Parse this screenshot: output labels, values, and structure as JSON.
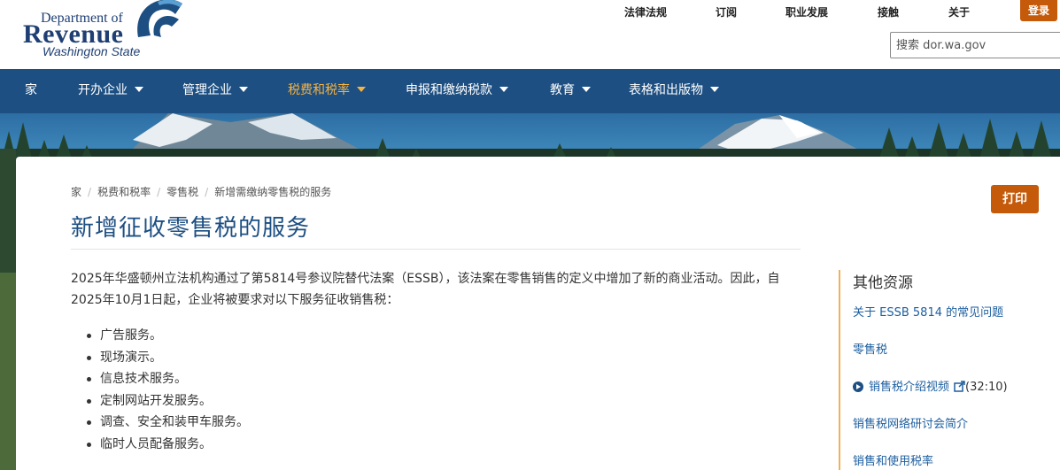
{
  "logo": {
    "line1": "Department of",
    "line2": "Revenue",
    "line3": "Washington State"
  },
  "util_nav": {
    "laws": "法律法规",
    "subscribe": "订阅",
    "careers": "职业发展",
    "contact": "接触",
    "about": "关于",
    "login": "登录"
  },
  "search": {
    "placeholder": "搜索 dor.wa.gov"
  },
  "main_nav": {
    "home": "家",
    "start_business": "开办企业",
    "manage_business": "管理企业",
    "taxes_rates": "税费和税率",
    "file_pay": "申报和缴纳税款",
    "education": "教育",
    "forms_pubs": "表格和出版物"
  },
  "breadcrumb": {
    "home": "家",
    "taxes_rates": "税费和税率",
    "retail_sales_tax": "零售税",
    "current": "新增需缴纳零售税的服务"
  },
  "print_label": "打印",
  "page_title": "新增征收零售税的服务",
  "intro": "2025年华盛顿州立法机构通过了第5814号参议院替代法案（ESSB），该法案在零售销售的定义中增加了新的商业活动。因此，自2025年10月1日起，企业将被要求对以下服务征收销售税：",
  "services": [
    "广告服务。",
    "现场演示。",
    "信息技术服务。",
    "定制网站开发服务。",
    "调查、安全和装甲车服务。",
    "临时人员配备服务。"
  ],
  "sidebar": {
    "title": "其他资源",
    "links": [
      "关于 ESSB 5814 的常见问题",
      "零售税",
      "销售税介绍视频",
      "销售税网络研讨会简介",
      "销售和使用税率"
    ],
    "video_duration": "(32:10)"
  },
  "colors": {
    "brand_blue": "#1d4f82",
    "accent_orange": "#c45a0a",
    "nav_active": "#f5b342",
    "sidebar_rule": "#f2b05c"
  }
}
